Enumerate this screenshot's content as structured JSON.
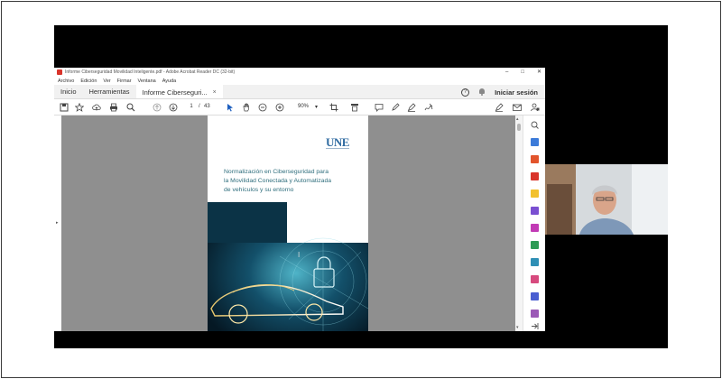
{
  "window": {
    "title": "Informe Ciberseguridad Movilidad Inteligente.pdf - Adobe Acrobat Reader DC (32-bit)",
    "controls": {
      "minimize": "–",
      "maximize": "□",
      "close": "✕"
    }
  },
  "menu": [
    "Archivo",
    "Edición",
    "Ver",
    "Firmar",
    "Ventana",
    "Ayuda"
  ],
  "tabs": {
    "home": "Inicio",
    "tools": "Herramientas",
    "document": "Informe Ciberseguri...",
    "document_close": "×"
  },
  "header_right": {
    "help": "?",
    "signin": "Iniciar sesión"
  },
  "toolbar": {
    "page_current": "1",
    "page_separator": "/",
    "page_total": "43",
    "zoom": "90%",
    "zoom_dropdown": "▾"
  },
  "document": {
    "logo": "UNE",
    "heading_lines": [
      "Normalización en Ciberseguridad para",
      "la Movilidad Conectada y Automatizada",
      "de vehículos y su entorno"
    ],
    "cursor": "I"
  },
  "panels": {
    "left_expand": "▸",
    "scroll_up": "▴",
    "scroll_down": "▾"
  },
  "icons": {
    "save": "save-icon",
    "bookmark": "star-icon",
    "upload": "cloud-upload-icon",
    "print": "printer-icon",
    "search": "magnifier-icon",
    "prev_page": "arrow-up-circle-icon",
    "next_page": "arrow-down-circle-icon",
    "select": "pointer-icon",
    "hand": "hand-icon",
    "zoom_out": "minus-circle-icon",
    "zoom_in": "plus-circle-icon",
    "crop": "crop-icon",
    "scroll_mode": "scroll-mode-icon",
    "comment": "comment-icon",
    "highlight": "pen-icon",
    "draw": "draw-icon",
    "sign": "sign-icon",
    "fill_sign": "fill-sign-icon",
    "share_mail": "mail-icon",
    "user": "user-lock-icon"
  },
  "colors": {
    "accent_blue": "#2e6aa0",
    "acrobat_red": "#d9342b",
    "heading_teal": "#2f6e7d",
    "panel_gray": "#8f8f8f"
  }
}
